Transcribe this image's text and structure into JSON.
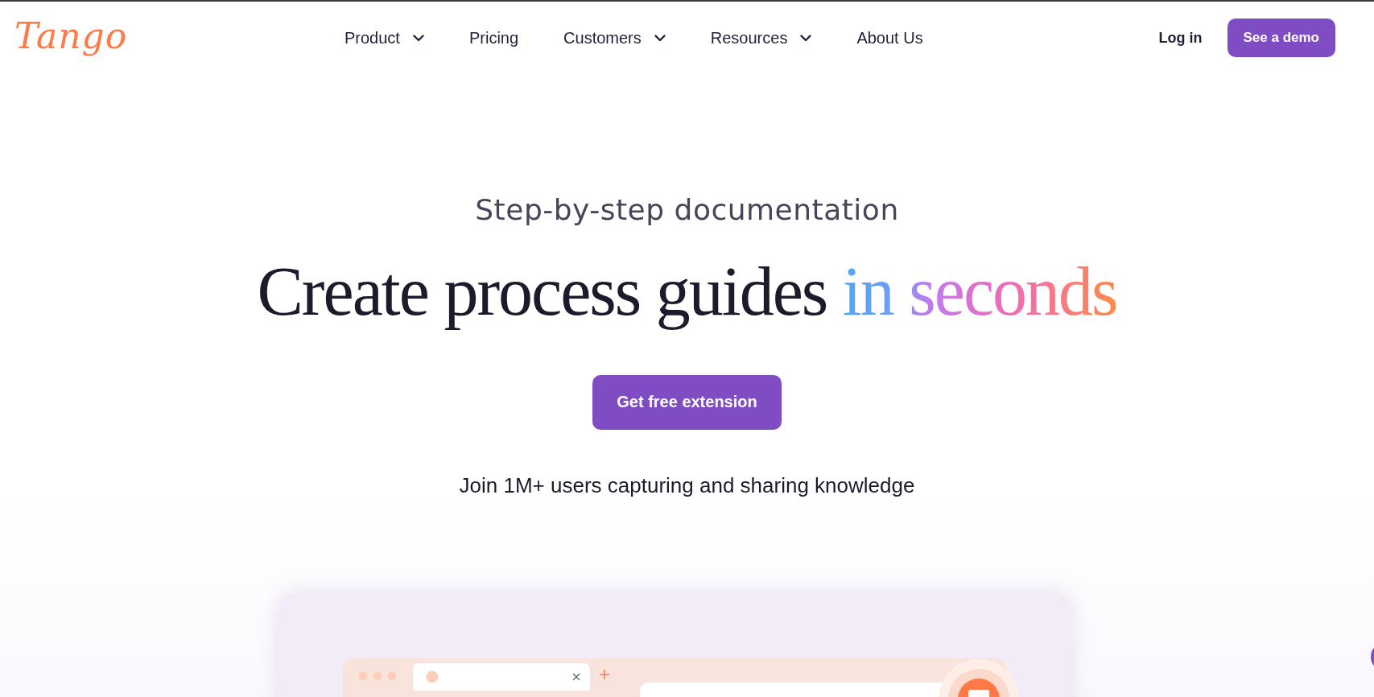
{
  "header": {
    "logo": "Tango",
    "nav": [
      {
        "label": "Product",
        "dropdown": true
      },
      {
        "label": "Pricing",
        "dropdown": false
      },
      {
        "label": "Customers",
        "dropdown": true
      },
      {
        "label": "Resources",
        "dropdown": true
      },
      {
        "label": "About Us",
        "dropdown": false
      }
    ],
    "login": "Log in",
    "demo_button": "See a demo"
  },
  "hero": {
    "eyebrow": "Step-by-step documentation",
    "headline": [
      {
        "text": "Create process guides ",
        "highlight": false
      },
      {
        "text": "in seconds",
        "highlight": true
      }
    ],
    "cta": "Get free extension",
    "tagline": "Join 1M+ users capturing and sharing knowledge"
  },
  "preview": {
    "kind": "browser-mockup"
  }
}
